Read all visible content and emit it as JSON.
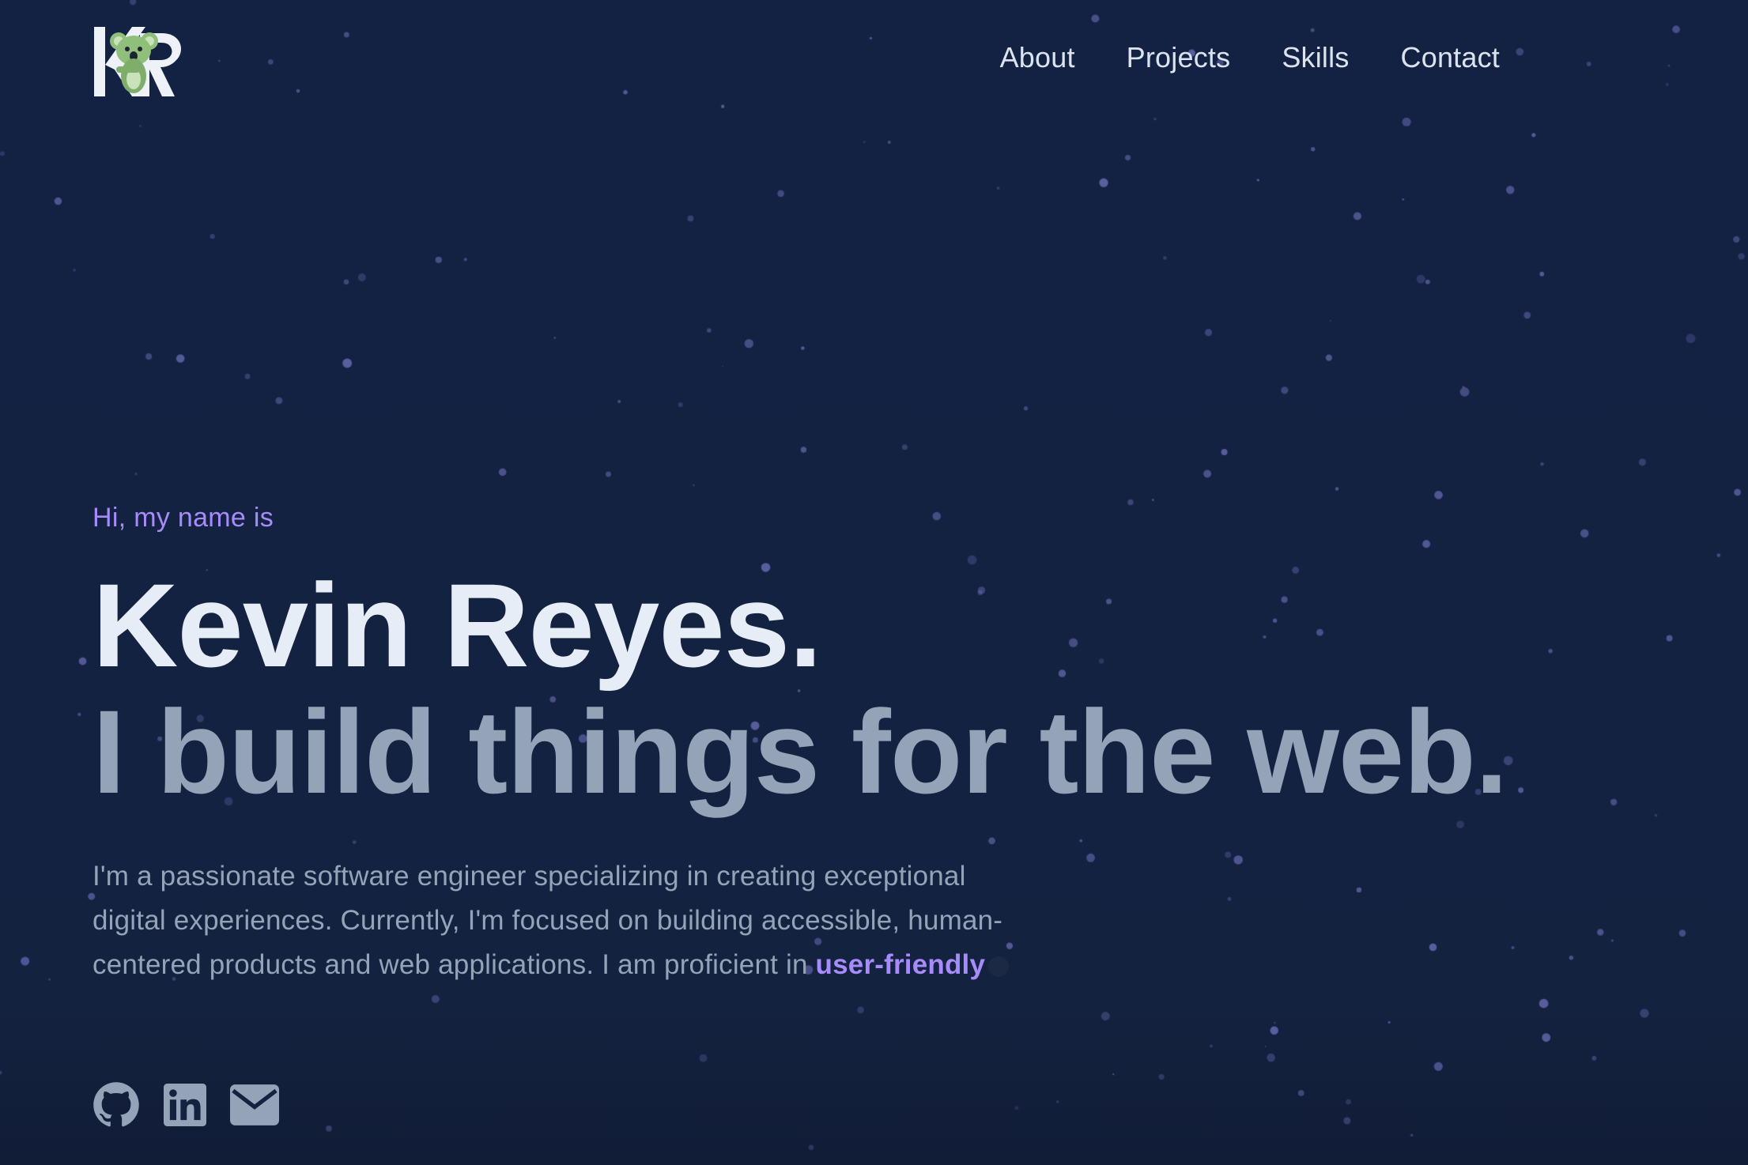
{
  "colors": {
    "background": "#13223f",
    "accent": "#a78bfa",
    "name": "#e7edf6",
    "muted": "#94a3b8",
    "nav": "#dbe3ef"
  },
  "header": {
    "logo_text": "KR",
    "logo_icon": "koala-icon",
    "nav": [
      "About",
      "Projects",
      "Skills",
      "Contact"
    ]
  },
  "hero": {
    "greeting": "Hi, my name is",
    "name": "Kevin Reyes.",
    "tagline": "I build things for the web.",
    "bio_text": "I'm a passionate software engineer specializing in creating exceptional digital experiences. Currently, I'm focused on building accessible, human-centered products and web applications. I am proficient in ",
    "bio_highlight": "user-friendly"
  },
  "socials": [
    {
      "icon": "github-icon"
    },
    {
      "icon": "linkedin-icon"
    },
    {
      "icon": "email-icon"
    }
  ]
}
